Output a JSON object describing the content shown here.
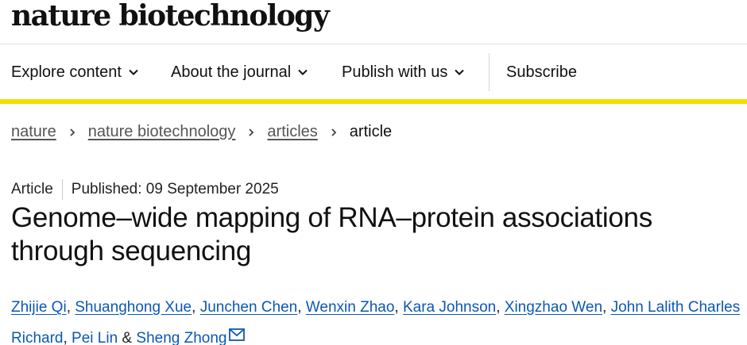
{
  "brand": {
    "logo_text": "nature biotechnology"
  },
  "nav": {
    "explore": "Explore content",
    "about": "About the journal",
    "publish": "Publish with us",
    "subscribe": "Subscribe"
  },
  "breadcrumb": {
    "items": [
      "nature",
      "nature biotechnology",
      "articles"
    ],
    "current": "article"
  },
  "article": {
    "type": "Article",
    "published": "Published: 09 September 2025",
    "title": "Genome–wide mapping of RNA–protein associations through sequencing",
    "authors": [
      "Zhijie Qi",
      "Shuanghong Xue",
      "Junchen Chen",
      "Wenxin Zhao",
      "Kara Johnson",
      "Xingzhao Wen",
      "John Lalith Charles Richard",
      "Pei Lin",
      "Sheng Zhong"
    ],
    "separator": ", ",
    "last_separator": " & "
  },
  "icons": {
    "chevron": "chevron-down-icon",
    "breadcrumb_separator": "chevron-right-icon",
    "mail": "mail-icon"
  },
  "colors": {
    "accent_bar": "#f2dd00",
    "link": "#0b57b5",
    "breadcrumb_link": "#555555"
  }
}
